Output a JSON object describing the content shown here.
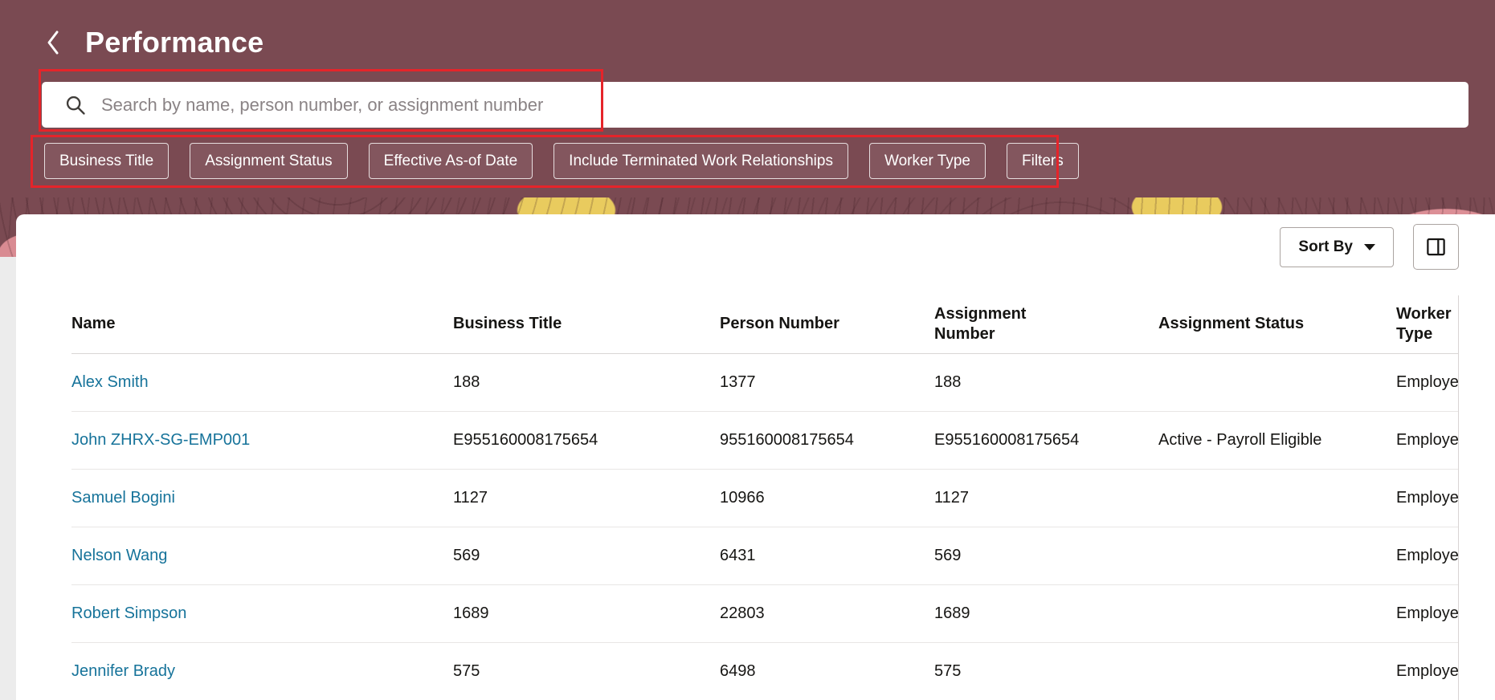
{
  "header": {
    "title": "Performance",
    "search": {
      "placeholder": "Search by name, person number, or assignment number"
    },
    "filter_chips": [
      "Business Title",
      "Assignment Status",
      "Effective As-of Date",
      "Include Terminated Work Relationships",
      "Worker Type",
      "Filters"
    ]
  },
  "toolbar": {
    "sort_by_label": "Sort By"
  },
  "table": {
    "columns": [
      "Name",
      "Business Title",
      "Person Number",
      "Assignment Number",
      "Assignment Status",
      "Worker Type"
    ],
    "rows": [
      {
        "name": "Alex Smith",
        "business_title": "188",
        "person_number": "1377",
        "assignment_number": "188",
        "assignment_status": "",
        "worker_type": "Employee"
      },
      {
        "name": "John ZHRX-SG-EMP001",
        "business_title": "E955160008175654",
        "person_number": "955160008175654",
        "assignment_number": "E955160008175654",
        "assignment_status": "Active - Payroll Eligible",
        "worker_type": "Employee"
      },
      {
        "name": "Samuel Bogini",
        "business_title": "1127",
        "person_number": "10966",
        "assignment_number": "1127",
        "assignment_status": "",
        "worker_type": "Employee"
      },
      {
        "name": "Nelson Wang",
        "business_title": "569",
        "person_number": "6431",
        "assignment_number": "569",
        "assignment_status": "",
        "worker_type": "Employee"
      },
      {
        "name": "Robert Simpson",
        "business_title": "1689",
        "person_number": "22803",
        "assignment_number": "1689",
        "assignment_status": "",
        "worker_type": "Employee"
      },
      {
        "name": "Jennifer Brady",
        "business_title": "575",
        "person_number": "6498",
        "assignment_number": "575",
        "assignment_status": "",
        "worker_type": "Employee"
      }
    ]
  },
  "colors": {
    "header_background": "#7a4a52",
    "annotation_red": "#e5242a",
    "link_teal": "#16739a",
    "accent_pink": "#dc8f96",
    "accent_yellow": "#e9cb5e"
  }
}
